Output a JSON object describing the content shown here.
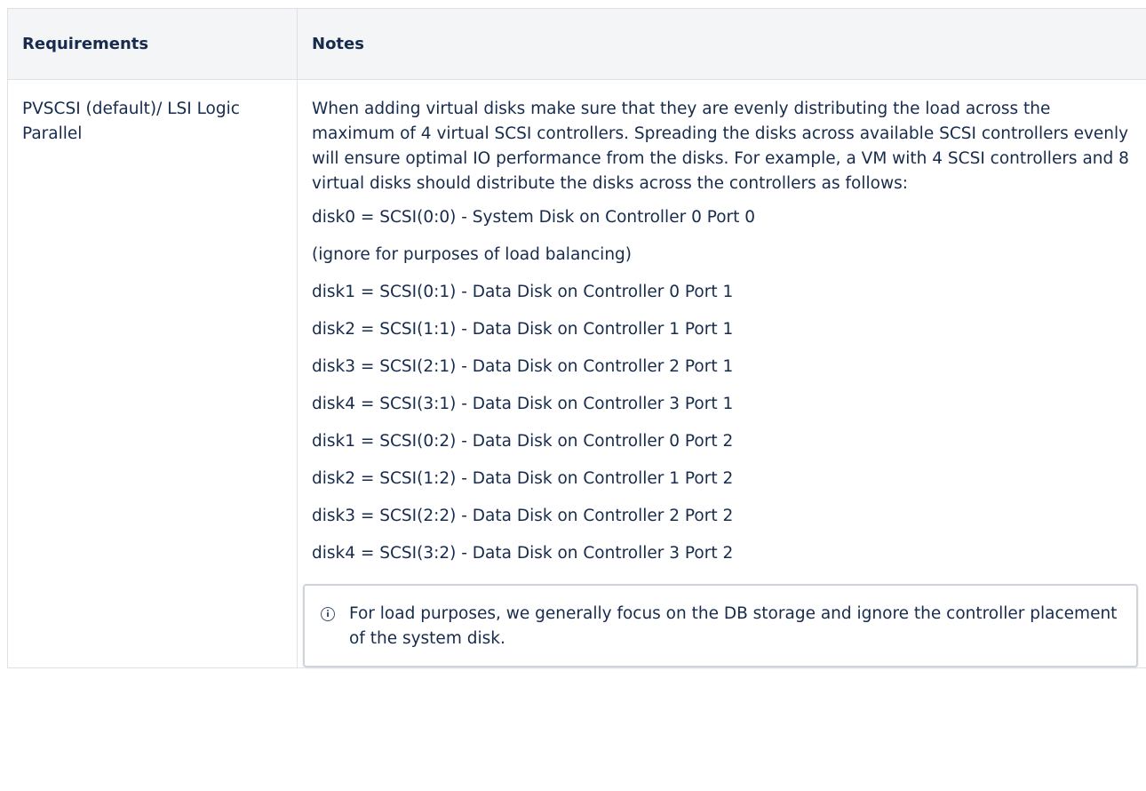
{
  "table": {
    "headers": [
      "Requirements",
      "Notes"
    ],
    "rows": [
      {
        "requirement": "PVSCSI (default)/ LSI Logic Parallel",
        "notes_intro": "When adding virtual disks make sure that they are evenly distributing the load across the maximum of 4 virtual SCSI controllers. Spreading the disks across available SCSI controllers evenly will ensure optimal IO performance from the disks. For example, a VM with 4 SCSI controllers and 8 virtual disks should distribute the disks across the controllers as follows:",
        "disk_lines": [
          "disk0 = SCSI(0:0) - System Disk on Controller 0 Port 0",
          "(ignore for purposes of load balancing)",
          "disk1 = SCSI(0:1) - Data Disk on Controller 0 Port 1",
          "disk2 = SCSI(1:1) - Data Disk on Controller 1 Port 1",
          "disk3 = SCSI(2:1) - Data Disk on Controller 2 Port 1",
          "disk4 = SCSI(3:1) - Data Disk on Controller 3 Port 1",
          "disk1 = SCSI(0:2) - Data Disk on Controller 0 Port 2",
          "disk2 = SCSI(1:2) - Data Disk on Controller 1 Port 2",
          "disk3 = SCSI(2:2) - Data Disk on Controller 2 Port 2",
          "disk4 = SCSI(3:2) - Data Disk on Controller 3 Port 2"
        ],
        "info_panel": {
          "icon": "info-icon",
          "text": "For load purposes, we generally focus on the DB storage and ignore the controller placement of the system disk."
        }
      }
    ]
  },
  "colors": {
    "header_bg": "#f4f5f7",
    "border": "#dfe1e6",
    "text": "#172b4d",
    "panel_border": "#cfd4db"
  }
}
